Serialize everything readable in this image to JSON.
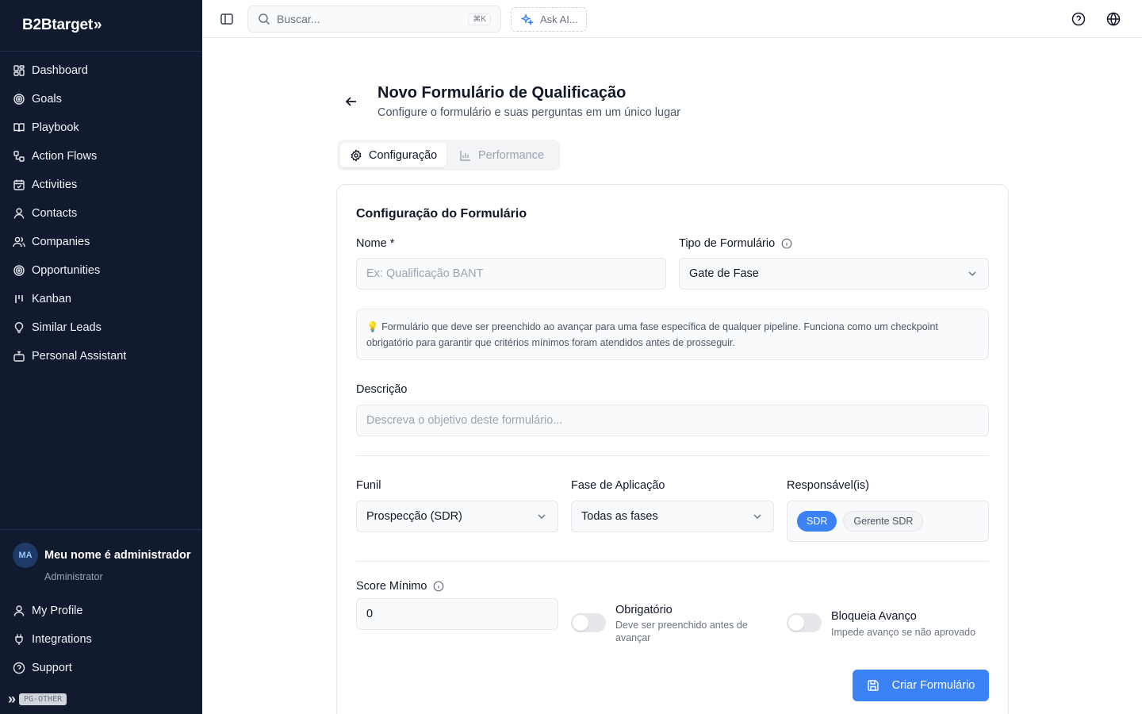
{
  "brand": {
    "name": "B2Btarget",
    "mark": "»"
  },
  "sidebar": {
    "items": [
      {
        "label": "Dashboard",
        "icon": "dashboard-icon"
      },
      {
        "label": "Goals",
        "icon": "target-icon"
      },
      {
        "label": "Playbook",
        "icon": "book-icon"
      },
      {
        "label": "Action Flows",
        "icon": "workflow-icon"
      },
      {
        "label": "Activities",
        "icon": "calendar-check-icon"
      },
      {
        "label": "Contacts",
        "icon": "user-icon"
      },
      {
        "label": "Companies",
        "icon": "users-icon"
      },
      {
        "label": "Opportunities",
        "icon": "target-icon"
      },
      {
        "label": "Kanban",
        "icon": "kanban-icon"
      },
      {
        "label": "Similar Leads",
        "icon": "lightbulb-icon"
      },
      {
        "label": "Personal Assistant",
        "icon": "bot-icon"
      }
    ],
    "user": {
      "initials": "MA",
      "name": "Meu nome é administrador",
      "role": "Administrator"
    },
    "bottom_items": [
      {
        "label": "My Profile",
        "icon": "user-icon"
      },
      {
        "label": "Integrations",
        "icon": "plug-icon"
      },
      {
        "label": "Support",
        "icon": "help-circle-icon"
      }
    ],
    "badge": "PG-OTHER"
  },
  "topbar": {
    "search_placeholder": "Buscar...",
    "search_shortcut": "⌘K",
    "ask_ai": "Ask AI..."
  },
  "page": {
    "title": "Novo Formulário de Qualificação",
    "subtitle": "Configure o formulário e suas perguntas em um único lugar",
    "tabs": [
      {
        "label": "Configuração",
        "active": true
      },
      {
        "label": "Performance",
        "active": false
      }
    ]
  },
  "form": {
    "section_title": "Configuração do Formulário",
    "name_label": "Nome *",
    "name_placeholder": "Ex: Qualificação BANT",
    "type_label": "Tipo de Formulário",
    "type_value": "Gate de Fase",
    "hint_emoji": "💡",
    "hint_text": "Formulário que deve ser preenchido ao avançar para uma fase específica de qualquer pipeline. Funciona como um checkpoint obrigatório para garantir que critérios mínimos foram atendidos antes de prosseguir.",
    "description_label": "Descrição",
    "description_placeholder": "Descreva o objetivo deste formulário...",
    "funnel_label": "Funil",
    "funnel_value": "Prospecção (SDR)",
    "phase_label": "Fase de Aplicação",
    "phase_value": "Todas as fases",
    "responsible_label": "Responsável(is)",
    "responsible_chips": [
      {
        "label": "SDR",
        "selected": true
      },
      {
        "label": "Gerente SDR",
        "selected": false
      }
    ],
    "min_score_label": "Score Mínimo",
    "min_score_value": "0",
    "required_title": "Obrigatório",
    "required_desc": "Deve ser preenchido antes de avançar",
    "required_on": false,
    "block_title": "Bloqueia Avanço",
    "block_desc": "Impede avanço se não aprovado",
    "block_on": false,
    "submit_label": "Criar Formulário"
  },
  "colors": {
    "sidebar_bg": "#111a2e",
    "accent": "#3b82f6"
  }
}
